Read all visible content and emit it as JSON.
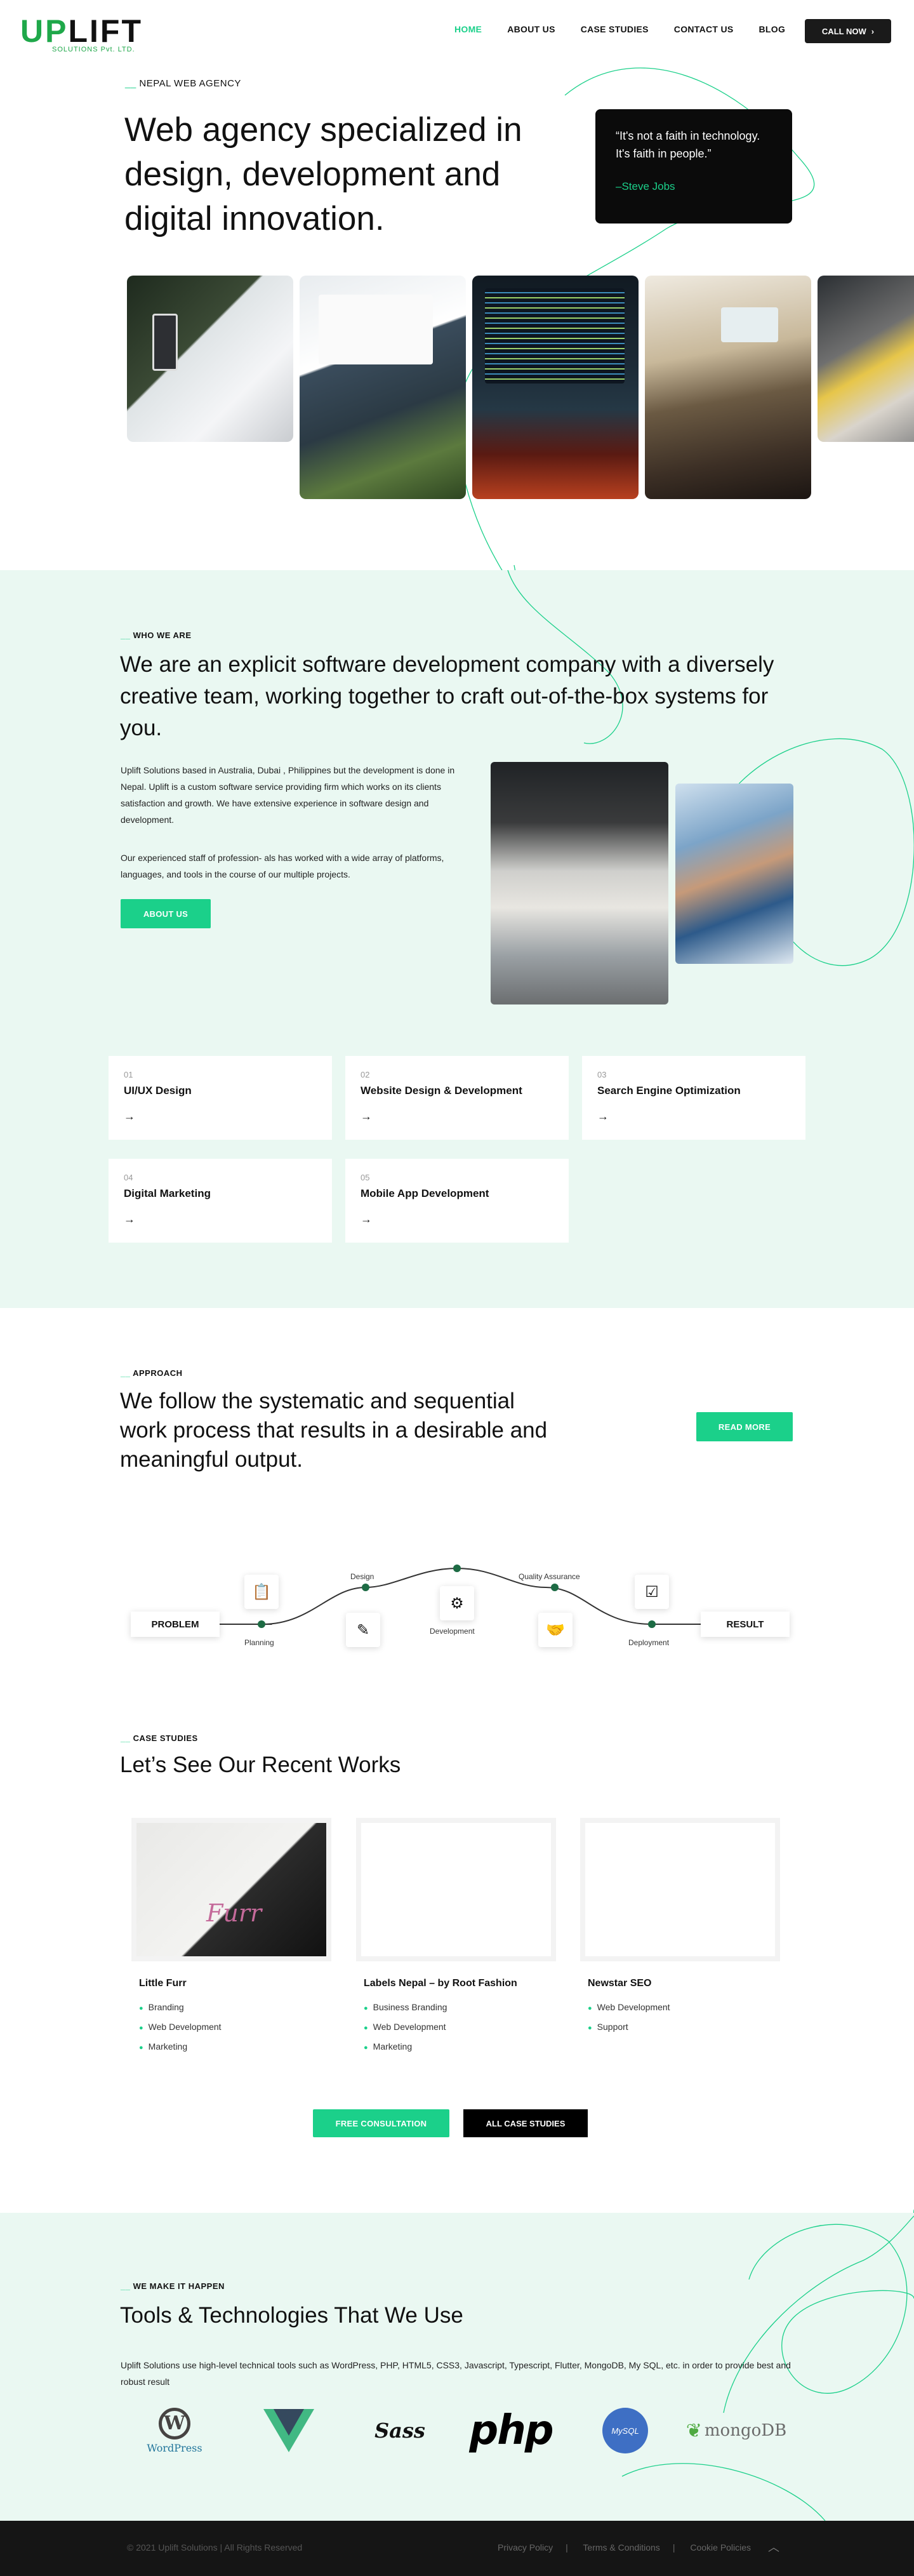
{
  "brand": {
    "name_part1": "UP",
    "name_part2": "LIFT",
    "tagline": "SOLUTIONS Pvt. LTD.",
    "accent": "#1bd08a",
    "logo_green": "#1fa84a"
  },
  "nav": {
    "items": [
      "HOME",
      "ABOUT US",
      "CASE STUDIES",
      "CONTACT US",
      "BLOG"
    ],
    "active": "HOME",
    "cta": "CALL NOW",
    "cta_icon": "chevron-right-icon"
  },
  "hero": {
    "eyebrow_dash": "__",
    "eyebrow": "NEPAL WEB AGENCY",
    "title": "Web agency specialized in design, development and digital innovation.",
    "quote": "“It's not a faith in technology. It's faith in people.”",
    "quote_author": "–Steve Jobs"
  },
  "who": {
    "eyebrow_dash": "__",
    "eyebrow": "WHO WE ARE",
    "title": "We are an explicit software development company with a diversely creative team, working together to craft out-of-the-box systems for you.",
    "p1": "Uplift Solutions based in Australia, Dubai , Philippines but the development is done in Nepal. Uplift is a custom software service providing firm which works on its clients satisfaction and growth. We have extensive experience in software design and development.",
    "p2": "Our experienced staff of profession- als has worked with a wide array of platforms, languages, and tools in the course of our multiple projects.",
    "button": "ABOUT US"
  },
  "services": [
    {
      "num": "01",
      "name": "UI/UX Design",
      "arrow": "→"
    },
    {
      "num": "02",
      "name": "Website Design & Development",
      "arrow": "→"
    },
    {
      "num": "03",
      "name": "Search Engine Optimization",
      "arrow": "→"
    },
    {
      "num": "04",
      "name": "Digital Marketing",
      "arrow": "→"
    },
    {
      "num": "05",
      "name": "Mobile App Development",
      "arrow": "→"
    }
  ],
  "approach": {
    "eyebrow_dash": "__",
    "eyebrow": "APPROACH",
    "title": "We follow the systematic and sequential work process that results in a desirable and meaningful output.",
    "button": "READ MORE",
    "start": "PROBLEM",
    "end": "RESULT",
    "steps": [
      "Planning",
      "Design",
      "Development",
      "Quality Assurance",
      "Deployment"
    ]
  },
  "case_studies": {
    "eyebrow_dash": "__",
    "eyebrow": "CASE STUDIES",
    "title": "Let’s See Our Recent Works",
    "cards": [
      {
        "title": "Little Furr",
        "thumb_text": "Furr",
        "tags": [
          "Branding",
          "Web Development",
          "Marketing"
        ]
      },
      {
        "title": "Labels Nepal – by Root Fashion",
        "tags": [
          "Business Branding",
          "Web Development",
          "Marketing"
        ]
      },
      {
        "title": "Newstar SEO",
        "tags": [
          "Web Development",
          "Support"
        ]
      }
    ],
    "btn_consult": "FREE CONSULTATION",
    "btn_all": "ALL CASE STUDIES"
  },
  "tools": {
    "eyebrow_dash": "__",
    "eyebrow": "WE MAKE IT HAPPEN",
    "title": "Tools & Technologies That We Use",
    "text": "Uplift Solutions use high-level technical tools such as WordPress, PHP, HTML5, CSS3, Javascript, Typescript, Flutter, MongoDB, My SQL, etc. in order to provide best and robust result",
    "logos": {
      "wordpress": "WordPress",
      "sass": "Sass",
      "php": "php",
      "mysql": "MySQL",
      "mongodb": "mongoDB"
    }
  },
  "footer": {
    "copyright": "© 2021 Uplift Solutions | All Rights Reserved",
    "links": [
      "Privacy Policy",
      "Terms & Conditions",
      "Cookie Policies"
    ],
    "separator": "|"
  }
}
